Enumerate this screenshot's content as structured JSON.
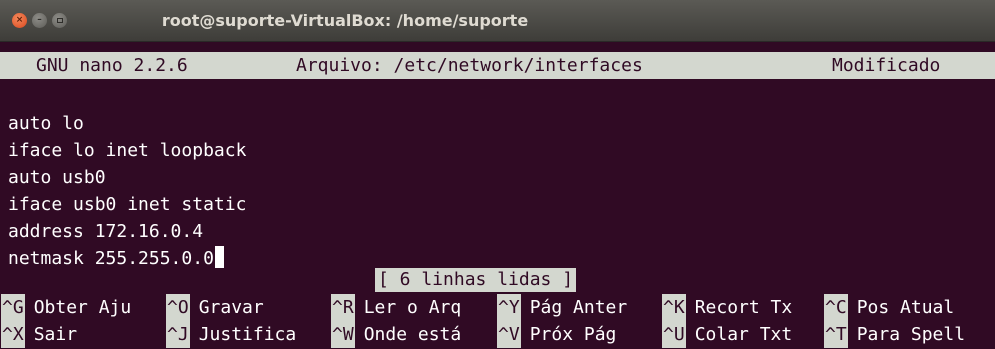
{
  "window": {
    "title": "root@suporte-VirtualBox: /home/suporte",
    "close_glyph": "×",
    "min_glyph": "–"
  },
  "nano": {
    "version": "GNU nano 2.2.6",
    "file_label": "Arquivo: /etc/network/interfaces",
    "state": "Modificado"
  },
  "lines": [
    "auto lo",
    "iface lo inet loopback",
    "auto usb0",
    "iface usb0 inet static",
    "address 172.16.0.4",
    "netmask 255.255.0.0"
  ],
  "status": "[ 6 linhas lidas ]",
  "shortcuts": {
    "row1": [
      {
        "key": "^G",
        "label": "Obter Aju"
      },
      {
        "key": "^O",
        "label": "Gravar"
      },
      {
        "key": "^R",
        "label": "Ler o Arq"
      },
      {
        "key": "^Y",
        "label": "Pág Anter"
      },
      {
        "key": "^K",
        "label": "Recort Tx"
      },
      {
        "key": "^C",
        "label": "Pos Atual"
      }
    ],
    "row2": [
      {
        "key": "^X",
        "label": "Sair"
      },
      {
        "key": "^J",
        "label": "Justifica"
      },
      {
        "key": "^W",
        "label": "Onde está"
      },
      {
        "key": "^V",
        "label": "Próx Pág"
      },
      {
        "key": "^U",
        "label": "Colar Txt"
      },
      {
        "key": "^T",
        "label": "Para Spell"
      }
    ]
  },
  "colors": {
    "terminal_bg": "#300a24",
    "inverse_bg": "#d3d7cf",
    "text": "#ffffff",
    "close_button": "#e9541e"
  }
}
